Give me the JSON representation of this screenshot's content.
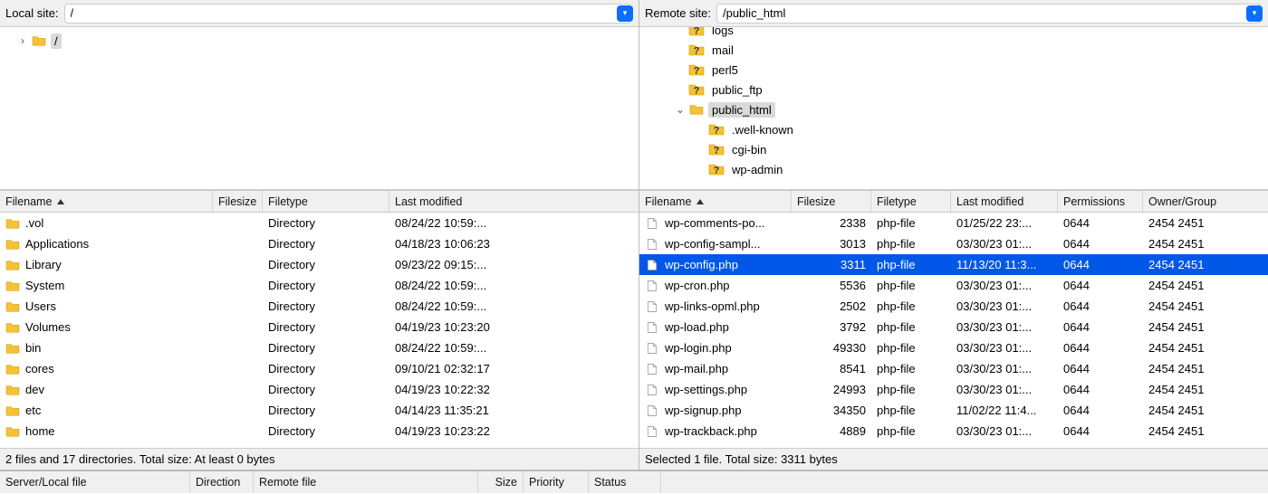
{
  "local": {
    "site_label": "Local site:",
    "path": "/",
    "tree": [
      {
        "type": "root",
        "label": "/",
        "indent": 18
      }
    ],
    "columns": {
      "filename": "Filename",
      "filesize": "Filesize",
      "filetype": "Filetype",
      "lastmod": "Last modified"
    },
    "col_widths": {
      "filename": 235,
      "filesize": 55,
      "filetype": 140,
      "lastmod": 240
    },
    "files": [
      {
        "name": ".vol",
        "size": "",
        "type": "Directory",
        "mod": "08/24/22 10:59:..."
      },
      {
        "name": "Applications",
        "size": "",
        "type": "Directory",
        "mod": "04/18/23 10:06:23"
      },
      {
        "name": "Library",
        "size": "",
        "type": "Directory",
        "mod": "09/23/22 09:15:..."
      },
      {
        "name": "System",
        "size": "",
        "type": "Directory",
        "mod": "08/24/22 10:59:..."
      },
      {
        "name": "Users",
        "size": "",
        "type": "Directory",
        "mod": "08/24/22 10:59:..."
      },
      {
        "name": "Volumes",
        "size": "",
        "type": "Directory",
        "mod": "04/19/23 10:23:20"
      },
      {
        "name": "bin",
        "size": "",
        "type": "Directory",
        "mod": "08/24/22 10:59:..."
      },
      {
        "name": "cores",
        "size": "",
        "type": "Directory",
        "mod": "09/10/21 02:32:17"
      },
      {
        "name": "dev",
        "size": "",
        "type": "Directory",
        "mod": "04/19/23 10:22:32"
      },
      {
        "name": "etc",
        "size": "",
        "type": "Directory",
        "mod": "04/14/23 11:35:21"
      },
      {
        "name": "home",
        "size": "",
        "type": "Directory",
        "mod": "04/19/23 10:23:22"
      }
    ],
    "status": "2 files and 17 directories. Total size: At least 0 bytes"
  },
  "remote": {
    "site_label": "Remote site:",
    "path": "/public_html",
    "tree": [
      {
        "kind": "q",
        "label": "logs",
        "clipped": true,
        "indent": 54
      },
      {
        "kind": "q",
        "label": "mail",
        "indent": 54
      },
      {
        "kind": "q",
        "label": "perl5",
        "indent": 54
      },
      {
        "kind": "q",
        "label": "public_ftp",
        "indent": 54
      },
      {
        "kind": "folder",
        "label": "public_html",
        "selected": true,
        "expanded": true,
        "indent": 54,
        "twist": "down"
      },
      {
        "kind": "q",
        "label": ".well-known",
        "indent": 76
      },
      {
        "kind": "q",
        "label": "cgi-bin",
        "indent": 76
      },
      {
        "kind": "q",
        "label": "wp-admin",
        "indent": 76
      }
    ],
    "columns": {
      "filename": "Filename",
      "filesize": "Filesize",
      "filetype": "Filetype",
      "lastmod": "Last modified",
      "perm": "Permissions",
      "owner": "Owner/Group"
    },
    "col_widths": {
      "filename": 168,
      "filesize": 88,
      "filetype": 88,
      "lastmod": 118,
      "perm": 94,
      "owner": 100
    },
    "files": [
      {
        "name": "wp-comments-po...",
        "size": "2338",
        "type": "php-file",
        "mod": "01/25/22 23:...",
        "perm": "0644",
        "owner": "2454 2451"
      },
      {
        "name": "wp-config-sampl...",
        "size": "3013",
        "type": "php-file",
        "mod": "03/30/23 01:...",
        "perm": "0644",
        "owner": "2454 2451"
      },
      {
        "name": "wp-config.php",
        "size": "3311",
        "type": "php-file",
        "mod": "11/13/20 11:3...",
        "perm": "0644",
        "owner": "2454 2451",
        "selected": true
      },
      {
        "name": "wp-cron.php",
        "size": "5536",
        "type": "php-file",
        "mod": "03/30/23 01:...",
        "perm": "0644",
        "owner": "2454 2451"
      },
      {
        "name": "wp-links-opml.php",
        "size": "2502",
        "type": "php-file",
        "mod": "03/30/23 01:...",
        "perm": "0644",
        "owner": "2454 2451"
      },
      {
        "name": "wp-load.php",
        "size": "3792",
        "type": "php-file",
        "mod": "03/30/23 01:...",
        "perm": "0644",
        "owner": "2454 2451"
      },
      {
        "name": "wp-login.php",
        "size": "49330",
        "type": "php-file",
        "mod": "03/30/23 01:...",
        "perm": "0644",
        "owner": "2454 2451"
      },
      {
        "name": "wp-mail.php",
        "size": "8541",
        "type": "php-file",
        "mod": "03/30/23 01:...",
        "perm": "0644",
        "owner": "2454 2451"
      },
      {
        "name": "wp-settings.php",
        "size": "24993",
        "type": "php-file",
        "mod": "03/30/23 01:...",
        "perm": "0644",
        "owner": "2454 2451"
      },
      {
        "name": "wp-signup.php",
        "size": "34350",
        "type": "php-file",
        "mod": "11/02/22 11:4...",
        "perm": "0644",
        "owner": "2454 2451"
      },
      {
        "name": "wp-trackback.php",
        "size": "4889",
        "type": "php-file",
        "mod": "03/30/23 01:...",
        "perm": "0644",
        "owner": "2454 2451"
      }
    ],
    "status": "Selected 1 file. Total size: 3311 bytes"
  },
  "transfer_columns": {
    "serverlocal": "Server/Local file",
    "direction": "Direction",
    "remotefile": "Remote file",
    "size": "Size",
    "priority": "Priority",
    "status": "Status"
  },
  "transfer_widths": {
    "serverlocal": 210,
    "direction": 70,
    "remotefile": 248,
    "size": 50,
    "priority": 72,
    "status": 80
  },
  "icons": {
    "chevron_down": "▾",
    "chevron_right": "›"
  }
}
